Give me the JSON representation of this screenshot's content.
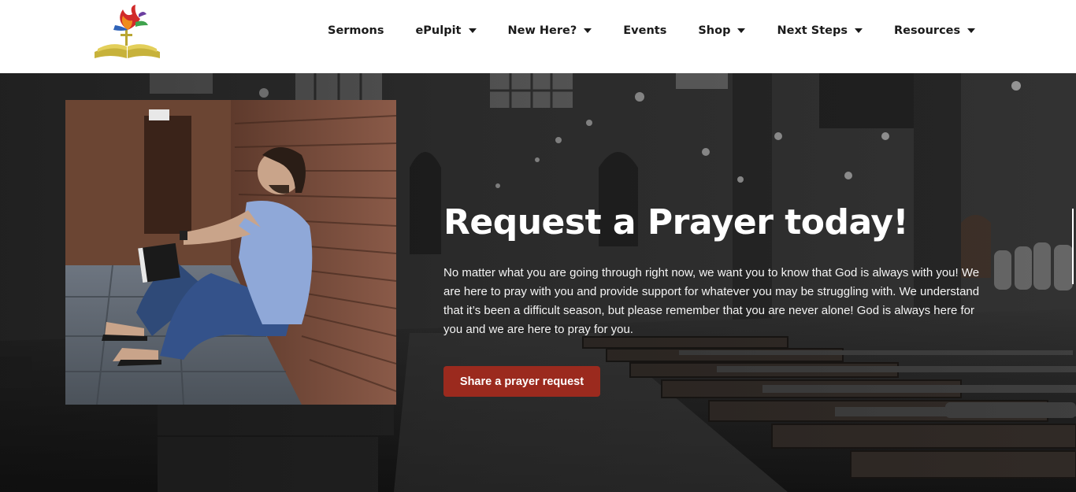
{
  "header": {
    "logo_alt": "church-logo",
    "nav": [
      {
        "label": "Sermons",
        "dropdown": false
      },
      {
        "label": "ePulpit",
        "dropdown": true
      },
      {
        "label": "New Here?",
        "dropdown": true
      },
      {
        "label": "Events",
        "dropdown": false
      },
      {
        "label": "Shop",
        "dropdown": true
      },
      {
        "label": "Next Steps",
        "dropdown": true
      },
      {
        "label": "Resources",
        "dropdown": true
      }
    ]
  },
  "hero": {
    "title": "Request a Prayer today!",
    "body": "No matter what you are going through right now, we want you to know that God is always with you! We are here to pray with you and provide support for whatever you may be struggling with. We understand that it’s been a difficult season, but please remember that you are never alone! God is always here for you and we are here to pray for you.",
    "cta_label": "Share a prayer request",
    "accent_color": "#9b2a1e"
  }
}
